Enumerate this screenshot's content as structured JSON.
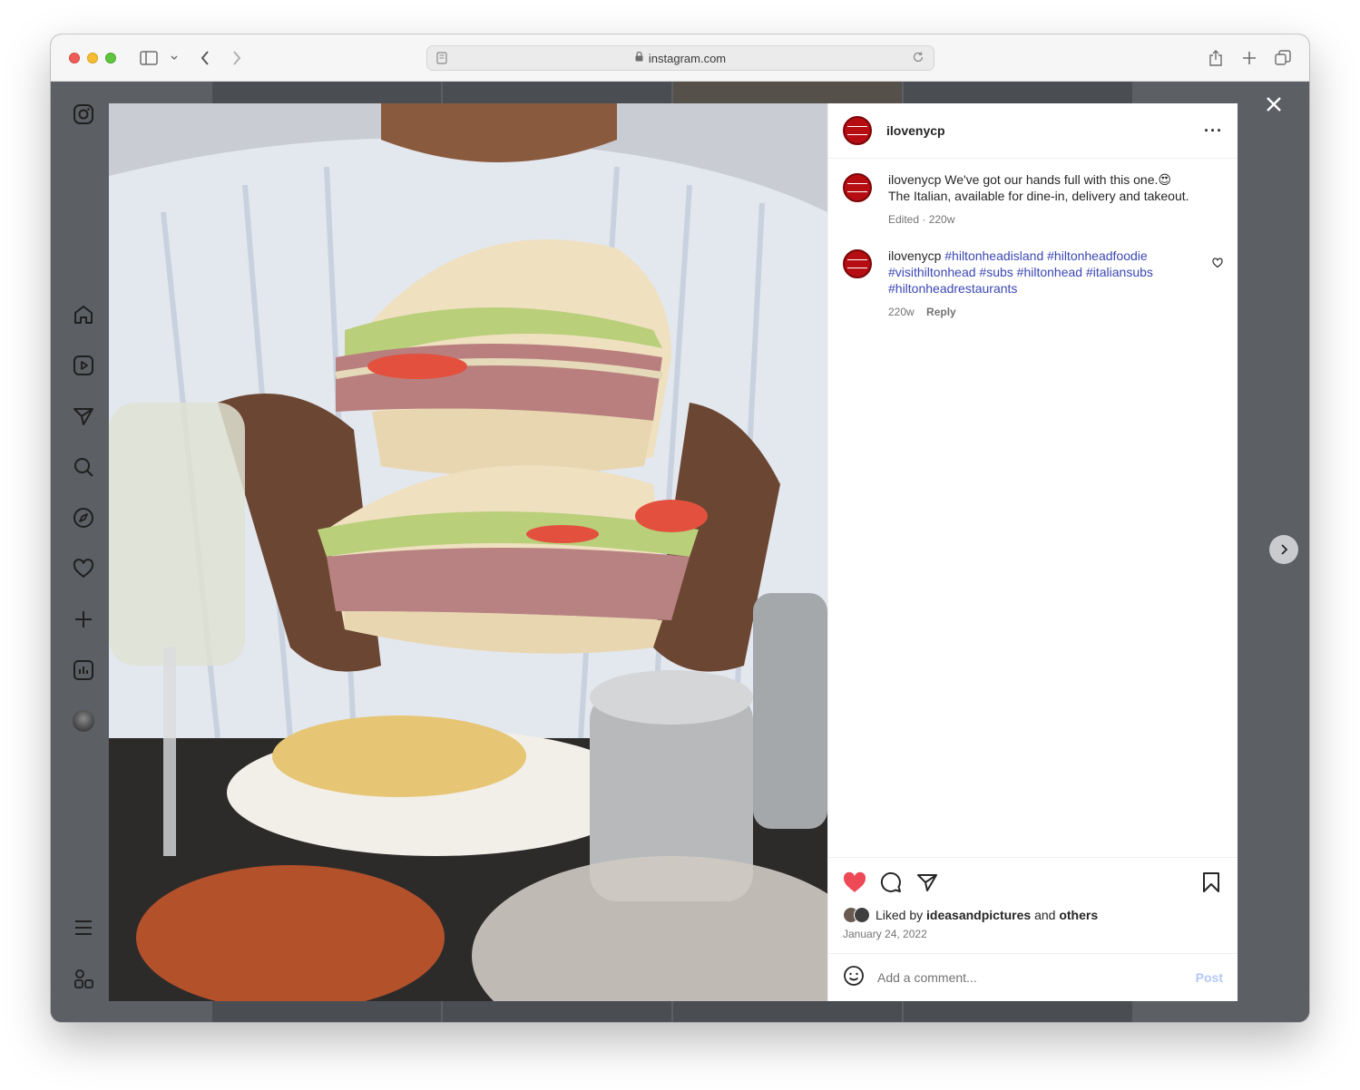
{
  "browser": {
    "url": "instagram.com"
  },
  "post": {
    "username": "ilovenycp",
    "caption": {
      "user": "ilovenycp",
      "line1": "We've got our hands full with this one.",
      "emoji": "😍",
      "line2": "The Italian, available for dine-in, delivery and takeout.",
      "meta": "Edited · 220w"
    },
    "hashtag_comment": {
      "user": "ilovenycp",
      "tags": [
        "#hiltonheadisland",
        "#hiltonheadfoodie",
        "#visithiltonhead",
        "#subs",
        "#hiltonhead",
        "#italiansubs",
        "#hiltonheadrestaurants"
      ],
      "time": "220w",
      "reply": "Reply"
    },
    "likes": {
      "prefix": "Liked by",
      "liker": "ideasandpictures",
      "conjunction": "and",
      "others": "others"
    },
    "date": "January 24, 2022",
    "comment_placeholder": "Add a comment...",
    "post_label": "Post"
  },
  "colors": {
    "like_red": "#ed4956",
    "link_blue": "#3b47b3",
    "avatar_red": "#b50d12",
    "post_disabled": "#b3c8f8"
  },
  "sidebar_icons": [
    "instagram-logo-icon",
    "home-icon",
    "reels-icon",
    "direct-icon",
    "search-icon",
    "explore-icon",
    "notifications-icon",
    "create-icon",
    "dashboard-icon",
    "profile-avatar",
    "more-menu-icon",
    "also-from-meta-icon"
  ]
}
